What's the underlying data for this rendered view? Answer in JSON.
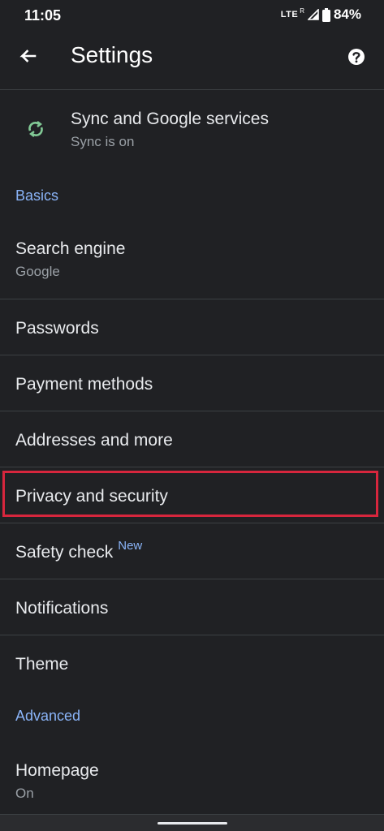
{
  "status_bar": {
    "time": "11:05",
    "network": "LTE",
    "network_sup": "R",
    "battery": "84%"
  },
  "header": {
    "title": "Settings",
    "back_icon": "arrow-back-icon",
    "help_icon": "help-icon"
  },
  "sync": {
    "title": "Sync and Google services",
    "subtitle": "Sync is on",
    "icon": "sync-icon",
    "icon_color": "#81c995"
  },
  "sections": {
    "basics": "Basics",
    "advanced": "Advanced"
  },
  "basics_items": [
    {
      "title": "Search engine",
      "subtitle": "Google"
    },
    {
      "title": "Passwords"
    },
    {
      "title": "Payment methods"
    },
    {
      "title": "Addresses and more"
    },
    {
      "title": "Privacy and security",
      "highlighted": true
    },
    {
      "title": "Safety check",
      "badge": "New"
    },
    {
      "title": "Notifications"
    },
    {
      "title": "Theme"
    }
  ],
  "advanced_items": [
    {
      "title": "Homepage",
      "subtitle": "On"
    }
  ],
  "colors": {
    "background": "#202124",
    "accent": "#8ab4f8",
    "highlight": "#d7263d"
  }
}
